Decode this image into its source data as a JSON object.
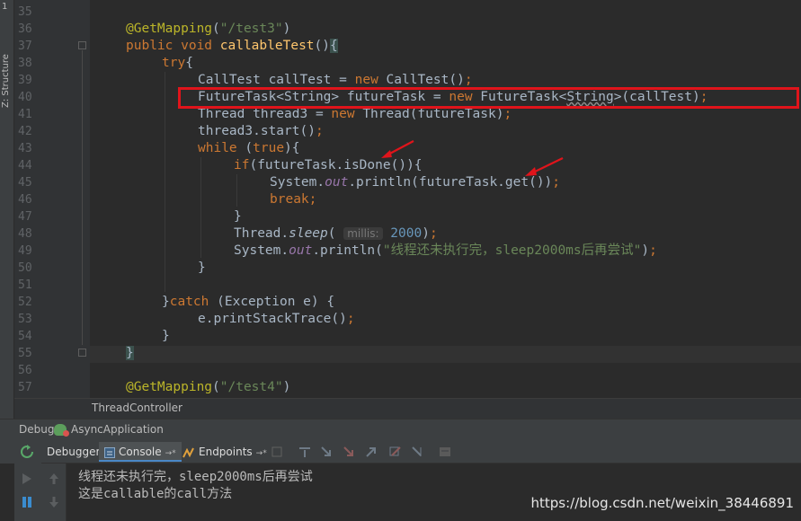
{
  "tool_strip": {
    "pin_label": "1",
    "structure_label": "Z: Structure"
  },
  "editor": {
    "line_numbers": [
      "35",
      "36",
      "37",
      "38",
      "39",
      "40",
      "41",
      "42",
      "43",
      "44",
      "45",
      "46",
      "47",
      "48",
      "49",
      "50",
      "51",
      "52",
      "53",
      "54",
      "55",
      "56",
      "57"
    ],
    "hint_label": "millis:",
    "sleep_value": "2000",
    "message_string": "\"线程还未执行完，sleep2000ms后再尝试\"",
    "mapping_test3": "\"/test3\"",
    "mapping_test4": "\"/test4\""
  },
  "breadcrumb": {
    "class_name": "ThreadController"
  },
  "debug_bar": {
    "label": "Debug",
    "app_name": "AsyncApplication"
  },
  "tabs": [
    {
      "label": "Debugger"
    },
    {
      "label": "Console"
    },
    {
      "label": "Endpoints"
    }
  ],
  "console": {
    "lines": [
      "线程还未执行完，sleep2000ms后再尝试",
      "这是callable的call方法"
    ]
  },
  "watermark": "https://blog.csdn.net/weixin_38446891",
  "colors": {
    "highlight_box": "#e0141b",
    "keyword": "#cc7832",
    "annotation": "#bbb529",
    "string": "#6a8759"
  }
}
